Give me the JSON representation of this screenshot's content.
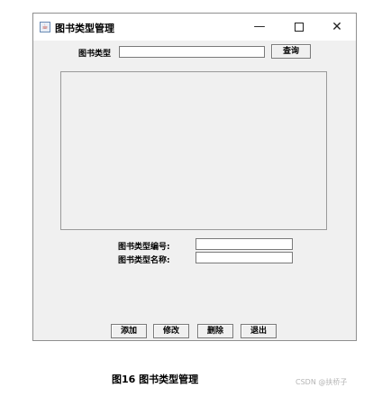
{
  "window": {
    "title": "图书类型管理",
    "controls": {
      "minimize": "—",
      "close": "✕"
    }
  },
  "search": {
    "label": "图书类型",
    "value": "",
    "button": "查询"
  },
  "form": {
    "id_label": "图书类型编号:",
    "id_value": "",
    "name_label": "图书类型名称:",
    "name_value": ""
  },
  "buttons": {
    "add": "添加",
    "edit": "修改",
    "delete": "删除",
    "exit": "退出"
  },
  "caption": "图16 图书类型管理",
  "watermark": "CSDN @扶桥子"
}
